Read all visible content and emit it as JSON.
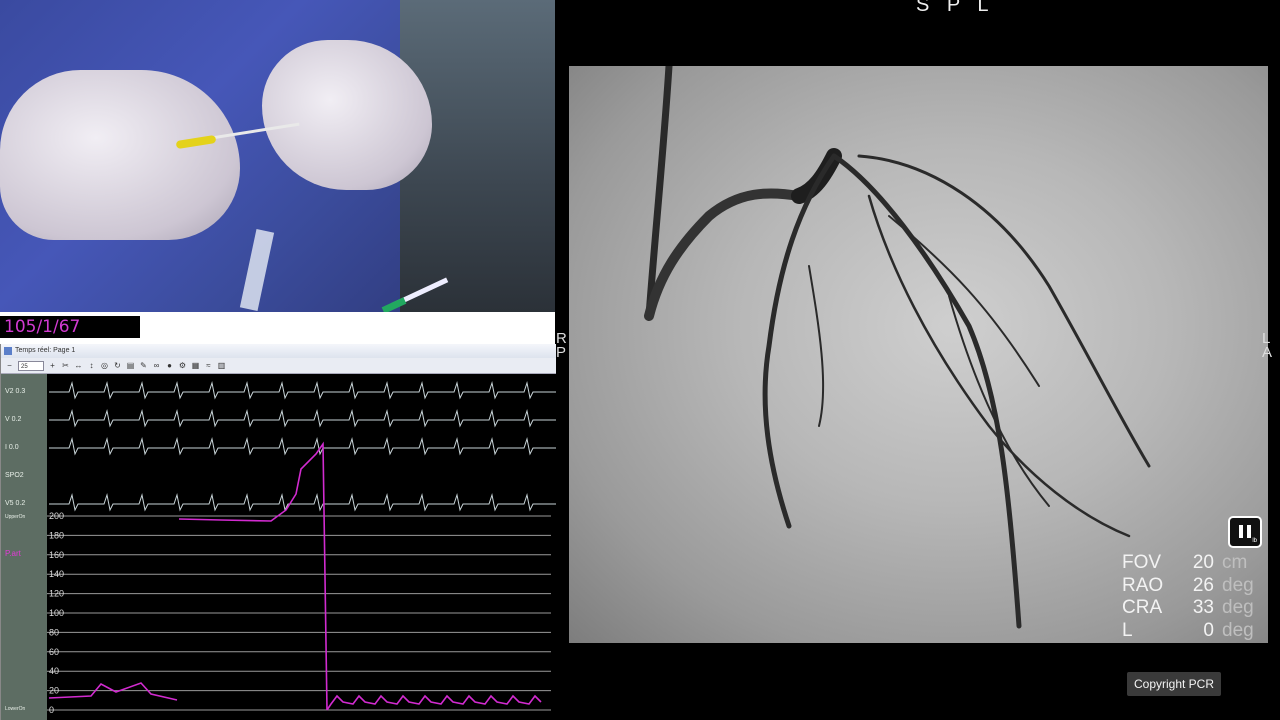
{
  "video": {
    "counter": "105/1/67"
  },
  "monitor": {
    "window_title": "Temps réel: Page 1",
    "zoom_value": "25",
    "lead_labels": [
      {
        "name": "v2",
        "text": "V2  0.3"
      },
      {
        "name": "v",
        "text": "V   0.2"
      },
      {
        "name": "i",
        "text": "I   0.0"
      },
      {
        "name": "spo2",
        "text": "SPO2"
      },
      {
        "name": "v5",
        "text": "V5  0.2"
      }
    ],
    "pressure_label": "P.art",
    "upper_lower_labels": {
      "upper": "UpperOn",
      "lower": "LowerOn"
    },
    "scale_ticks": [
      "200",
      "180",
      "160",
      "140",
      "120",
      "100",
      "80",
      "60",
      "40",
      "20",
      "0"
    ],
    "colors": {
      "ecg": "#c8d4d8",
      "pressure": "#d22bd0",
      "grid": "#9a9a9a"
    }
  },
  "angiography": {
    "view_label": "S P L",
    "side_left_marker": "R\nP",
    "side_right_marker": "L\nA",
    "info": [
      {
        "key": "FOV",
        "value": "20",
        "unit": "cm"
      },
      {
        "key": "RAO",
        "value": "26",
        "unit": "deg"
      },
      {
        "key": "CRA",
        "value": "33",
        "unit": "deg"
      },
      {
        "key": "L",
        "value": "0",
        "unit": "deg"
      }
    ],
    "pause_sub": "lb"
  },
  "copyright": "Copyright PCR"
}
